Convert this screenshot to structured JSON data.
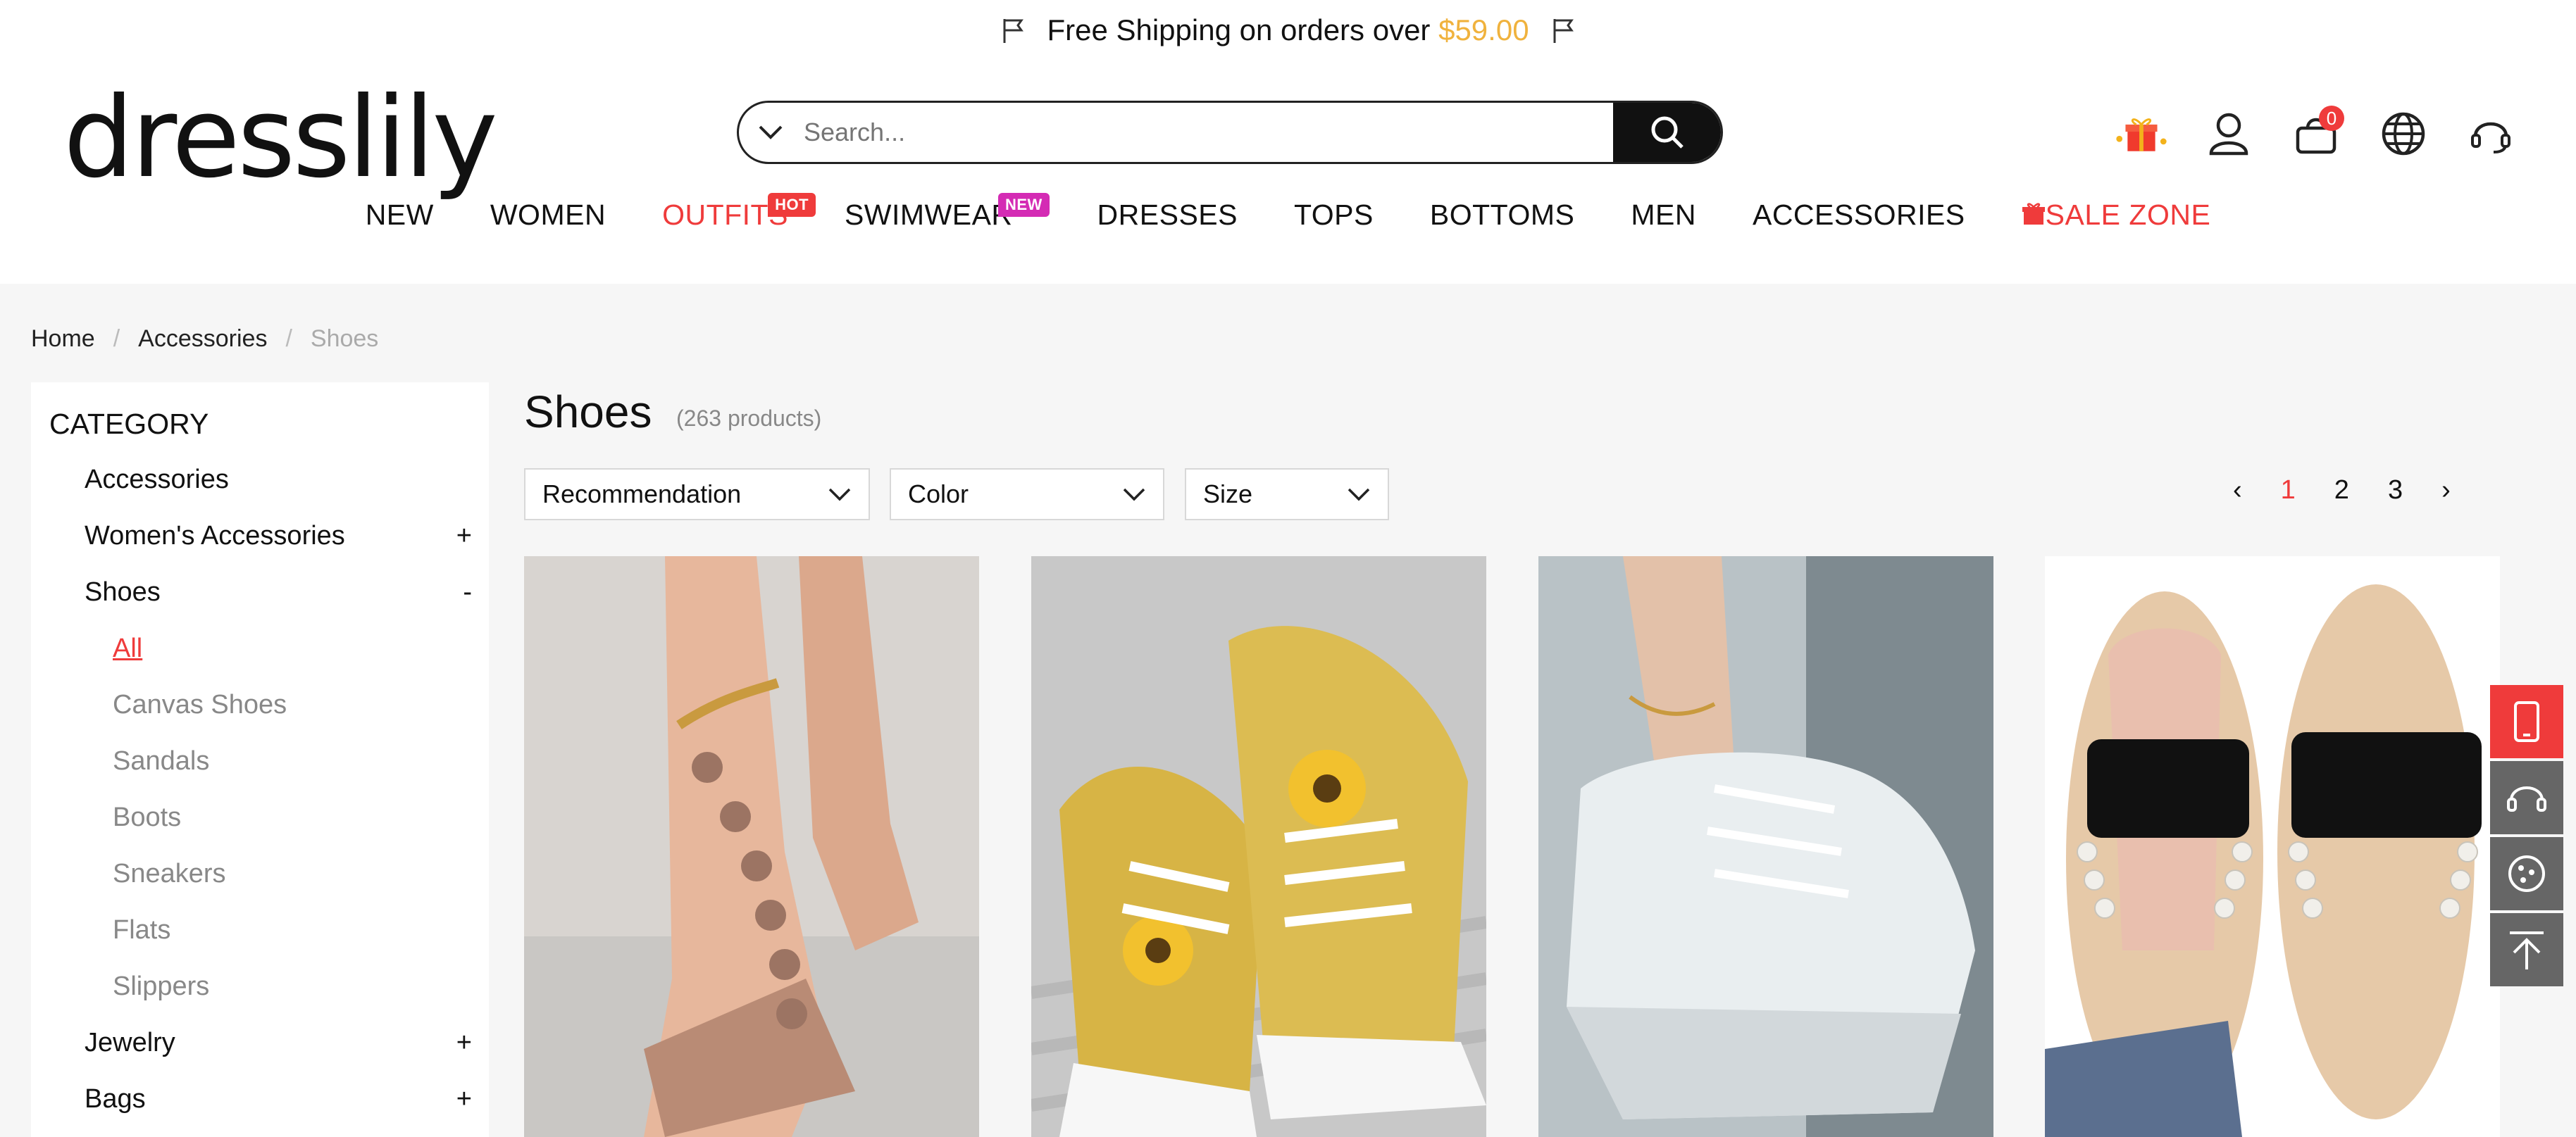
{
  "promo": {
    "text": "Free Shipping on orders over",
    "amount": "$59.00"
  },
  "brand": {
    "logo": "dresslily"
  },
  "search": {
    "placeholder": "Search..."
  },
  "header": {
    "cart_count": "0"
  },
  "nav": [
    {
      "label": "NEW"
    },
    {
      "label": "WOMEN"
    },
    {
      "label": "OUTFITS",
      "badge": "HOT"
    },
    {
      "label": "SWIMWEAR",
      "badge": "NEW"
    },
    {
      "label": "DRESSES"
    },
    {
      "label": "TOPS"
    },
    {
      "label": "BOTTOMS"
    },
    {
      "label": "MEN"
    },
    {
      "label": "ACCESSORIES"
    },
    {
      "label": "SALE ZONE"
    }
  ],
  "breadcrumb": [
    "Home",
    "Accessories",
    "Shoes"
  ],
  "sidebar": {
    "title": "CATEGORY",
    "items": [
      {
        "label": "Accessories",
        "toggle": ""
      },
      {
        "label": "Women's Accessories",
        "toggle": "+"
      },
      {
        "label": "Shoes",
        "toggle": "-"
      },
      {
        "label": "Jewelry",
        "toggle": "+"
      },
      {
        "label": "Bags",
        "toggle": "+"
      }
    ],
    "subitems": [
      "All",
      "Canvas Shoes",
      "Sandals",
      "Boots",
      "Sneakers",
      "Flats",
      "Slippers"
    ]
  },
  "listing": {
    "title": "Shoes",
    "count": "(263 products)"
  },
  "filters": {
    "sort": "Recommendation",
    "color": "Color",
    "size": "Size"
  },
  "pagination": {
    "prev": "‹",
    "pages": [
      "1",
      "2",
      "3"
    ],
    "next": "›"
  },
  "colors": {
    "accent": "#ef3b3b",
    "price": "#f0b23d",
    "new_badge": "#d42bb4"
  }
}
